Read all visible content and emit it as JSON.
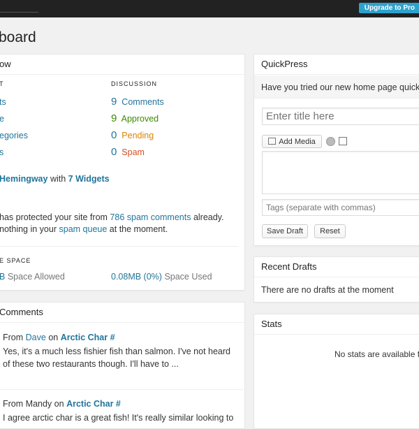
{
  "adminbar": {
    "upgrade_label": "Upgrade to Pro"
  },
  "page": {
    "title": "board"
  },
  "right_now": {
    "title": "ow",
    "content_header": "T",
    "discussion_header": "DISCUSSION",
    "content_items": [
      "ts",
      "e",
      "egories",
      "s"
    ],
    "discussion": [
      {
        "count": "9",
        "label": "Comments"
      },
      {
        "count": "9",
        "label": "Approved"
      },
      {
        "count": "0",
        "label": "Pending"
      },
      {
        "count": "0",
        "label": "Spam"
      }
    ],
    "theme_name": "Hemingway",
    "theme_with": "with",
    "widgets_link": "7 Widgets",
    "akismet_line1_prefix": "has protected your site from",
    "akismet_spam_link": "786 spam comments",
    "akismet_line1_suffix": "already.",
    "akismet_line2_prefix": "nothing in your",
    "akismet_queue_link": "spam queue",
    "akismet_line2_suffix": "at the moment.",
    "space_header": "E SPACE",
    "space_allowed_value": "B",
    "space_allowed_label": "Space Allowed",
    "space_used_value": "0.08MB (0%)",
    "space_used_label": "Space Used"
  },
  "recent_comments": {
    "title": "Comments",
    "items": [
      {
        "from": "From",
        "author": "Dave",
        "on": "on",
        "post": "Arctic Char #",
        "line1": "Yes, it's a much less fishier fish than salmon. I've not heard",
        "line2": "of these two restaurants though. I'll have to ..."
      },
      {
        "from": "From",
        "author": "Mandy",
        "on": "on",
        "post": "Arctic Char #",
        "line1": "I agree arctic char is a great fish! It's really similar looking to"
      }
    ]
  },
  "quickpress": {
    "title": "QuickPress",
    "notice": "Have you tried our new home page quick",
    "title_placeholder": "Enter title here",
    "add_media_label": "Add Media",
    "tags_placeholder": "Tags (separate with commas)",
    "save_draft_label": "Save Draft",
    "reset_label": "Reset"
  },
  "recent_drafts": {
    "title": "Recent Drafts",
    "empty": "There are no drafts at the moment"
  },
  "stats": {
    "title": "Stats",
    "empty": "No stats are available fo"
  }
}
